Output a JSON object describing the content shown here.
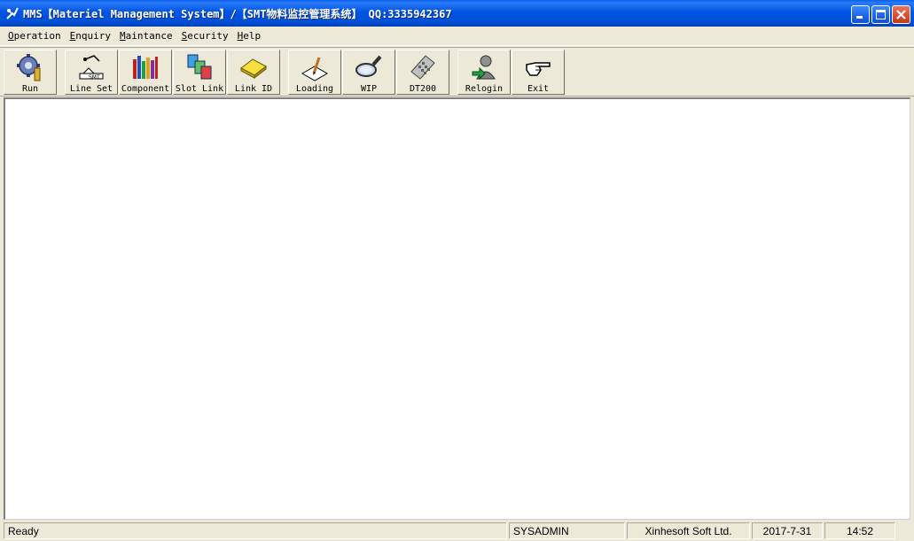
{
  "window": {
    "title": "MMS【Materiel Management System】/【SMT物料监控管理系统】 QQ:3335942367",
    "icon": "mms-app-icon"
  },
  "menu": [
    {
      "label": "Operation",
      "underline": "O",
      "rest": "peration"
    },
    {
      "label": "Enquiry",
      "underline": "E",
      "rest": "nquiry"
    },
    {
      "label": "Maintance",
      "underline": "M",
      "rest": "aintance"
    },
    {
      "label": "Security",
      "underline": "S",
      "rest": "ecurity"
    },
    {
      "label": "Help",
      "underline": "H",
      "rest": "elp"
    }
  ],
  "toolbar": [
    {
      "label": "Run",
      "icon": "gear-run-icon"
    },
    {
      "label": "Line Set",
      "icon": "line-set-icon"
    },
    {
      "label": "Component",
      "icon": "component-books-icon"
    },
    {
      "label": "Slot Link",
      "icon": "slot-link-icon"
    },
    {
      "label": "Link ID",
      "icon": "link-id-icon"
    },
    {
      "label": "Loading",
      "icon": "loading-pen-icon"
    },
    {
      "label": "WIP",
      "icon": "magnifier-icon"
    },
    {
      "label": "DT200",
      "icon": "keypad-device-icon"
    },
    {
      "label": "Relogin",
      "icon": "user-relogin-icon"
    },
    {
      "label": "Exit",
      "icon": "hand-pointer-icon"
    }
  ],
  "status": {
    "message": "Ready",
    "user": "SYSADMIN",
    "company": "Xinhesoft Soft Ltd.",
    "date": "2017-7-31",
    "time": "14:52"
  },
  "colors": {
    "titlebar": "#0054e3",
    "chrome": "#ece9d8",
    "client": "#ffffff"
  }
}
